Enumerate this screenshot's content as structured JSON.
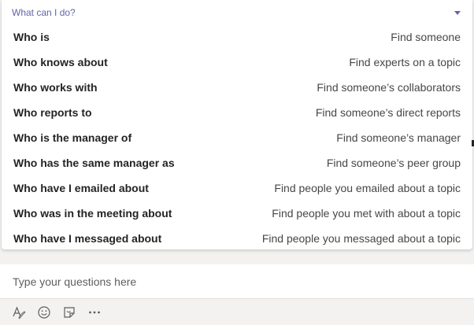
{
  "background_fragment": "...",
  "popup": {
    "title": "What can I do?",
    "items": [
      {
        "command": "Who is",
        "description": "Find someone"
      },
      {
        "command": "Who knows about",
        "description": "Find experts on a topic"
      },
      {
        "command": "Who works with",
        "description": "Find someone’s collaborators"
      },
      {
        "command": "Who reports to",
        "description": "Find someone’s direct reports"
      },
      {
        "command": "Who is the manager of",
        "description": "Find someone’s manager"
      },
      {
        "command": "Who has the same manager as",
        "description": "Find someone’s peer group"
      },
      {
        "command": "Who have I emailed about",
        "description": "Find people you emailed about a topic"
      },
      {
        "command": "Who was in the meeting about",
        "description": "Find people you met with about a topic"
      },
      {
        "command": "Who have I messaged about",
        "description": "Find people you messaged about a topic"
      }
    ]
  },
  "compose": {
    "placeholder": "Type your questions here"
  },
  "toolbar": {
    "icons": [
      "format-icon",
      "emoji-icon",
      "sticker-icon",
      "more-options-icon"
    ]
  },
  "colors": {
    "accent": "#6264a7",
    "text": "#252423",
    "secondary_text": "#484644",
    "background": "#f3f2f1"
  }
}
